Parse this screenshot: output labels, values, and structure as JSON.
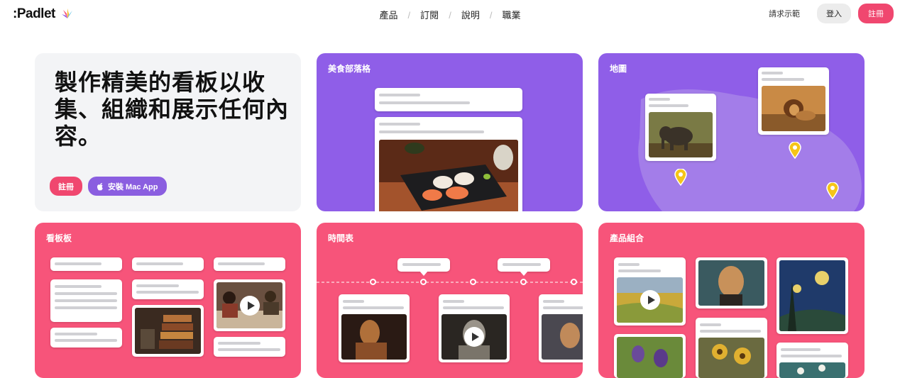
{
  "header": {
    "logo": ":Padlet",
    "nav": [
      "產品",
      "訂閱",
      "說明",
      "職業"
    ],
    "demo_link": "請求示範",
    "login": "登入",
    "signup": "註冊"
  },
  "hero": {
    "headline": "製作精美的看板以收集、組織和展示任何內容。",
    "signup_button": "註冊",
    "mac_button": "安裝 Mac App"
  },
  "cards": {
    "blog": "美食部落格",
    "map": "地圖",
    "board": "看板板",
    "timeline": "時間表",
    "portfolio": "產品組合"
  },
  "colors": {
    "brand_pink": "#f0476f",
    "purple": "#8f5ee8",
    "card_pink": "#f7547a"
  }
}
